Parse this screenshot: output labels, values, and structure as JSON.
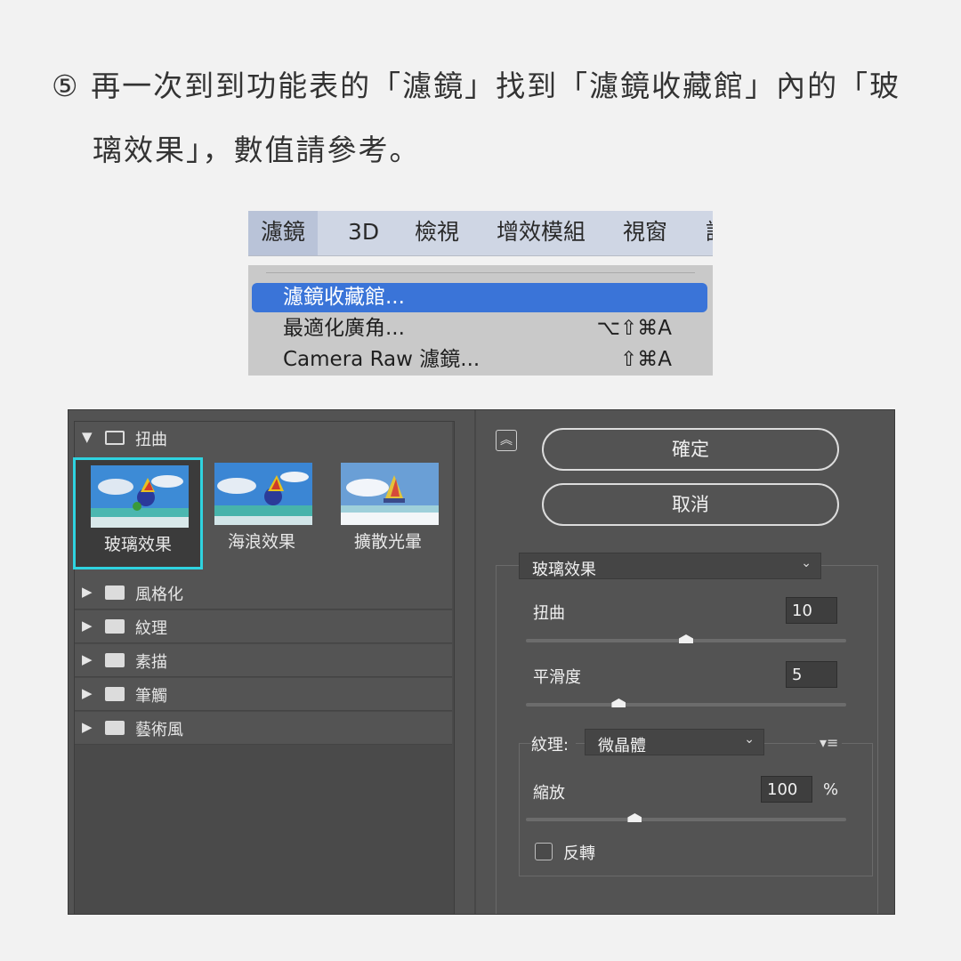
{
  "instruction": {
    "line1": "⑤ 再一次到到功能表的「濾鏡」找到「濾鏡收藏館」內的「玻",
    "line2": "璃效果」，數值請參考。"
  },
  "menubar": {
    "items": [
      "濾鏡",
      "3D",
      "檢視",
      "增效模組",
      "視窗",
      "說"
    ]
  },
  "dropdown": {
    "items": [
      {
        "label": "濾鏡收藏館...",
        "shortcut": ""
      },
      {
        "label": "最適化廣角...",
        "shortcut": "⌥⇧⌘A"
      },
      {
        "label": "Camera Raw 濾鏡...",
        "shortcut": "⇧⌘A"
      }
    ]
  },
  "gallery": {
    "open_category": "扭曲",
    "thumbnails": [
      "玻璃效果",
      "海浪效果",
      "擴散光暈"
    ],
    "selected_thumbnail": "玻璃效果",
    "categories": [
      "風格化",
      "紋理",
      "素描",
      "筆觸",
      "藝術風"
    ]
  },
  "actions": {
    "ok_label": "確定",
    "cancel_label": "取消"
  },
  "settings": {
    "filter_select": "玻璃效果",
    "distortion_label": "扭曲",
    "distortion_value": "10",
    "distortion_fraction": 0.5,
    "smoothness_label": "平滑度",
    "smoothness_value": "5",
    "smoothness_fraction": 0.29,
    "texture_label": "紋理:",
    "texture_select": "微晶體",
    "scaling_label": "縮放",
    "scaling_value": "100",
    "scaling_unit": "%",
    "scaling_fraction": 0.34,
    "invert_label": "反轉",
    "invert_checked": false
  },
  "icons": {
    "collapse": "collapse-chevrons-icon",
    "texture_menu": "texture-menu-icon"
  }
}
